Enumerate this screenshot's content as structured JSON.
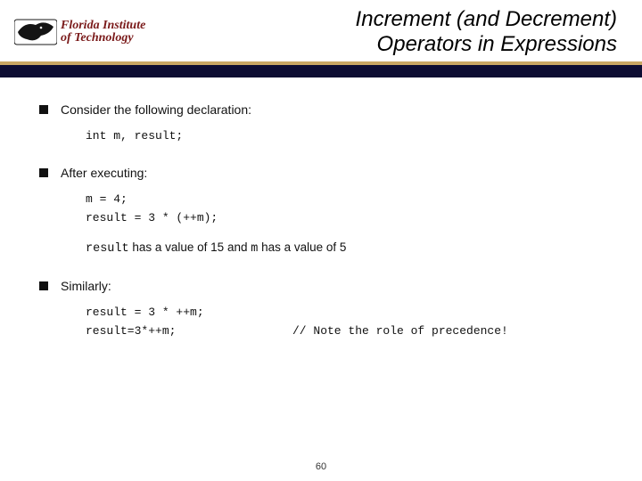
{
  "header": {
    "logo_line1": "Florida Institute",
    "logo_line2": "of Technology",
    "title_line1": "Increment (and Decrement)",
    "title_line2": "Operators in Expressions"
  },
  "body": {
    "b1": "Consider the following declaration:",
    "code1": "int m, result;",
    "b2": "After executing:",
    "code2a": "m = 4;",
    "code2b": "result = 3 * (++m);",
    "result_prefix": "result",
    "result_mid1": " has a value of ",
    "result_val1": "15",
    "result_mid2": " and ",
    "result_var2": "m",
    "result_mid3": " has a value of ",
    "result_val2": "5",
    "b3": "Similarly:",
    "code3a": "result = 3 * ++m;",
    "code3b": "result=3*++m;",
    "note": "// Note the role of precedence!"
  },
  "page": "60"
}
